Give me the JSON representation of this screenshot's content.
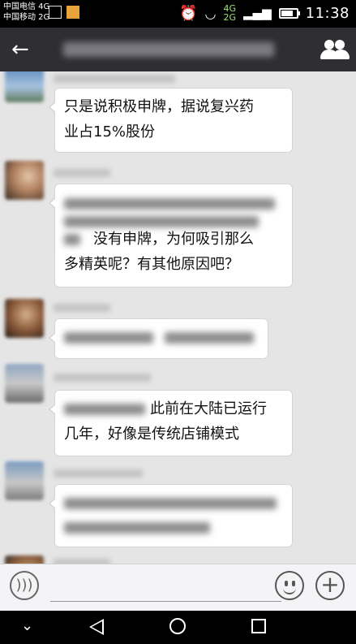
{
  "status_bar": {
    "carrier_1": "中国电信 4G",
    "carrier_2": "中国移动 2G",
    "network_1": "4G",
    "network_2": "2G",
    "time": "11:38",
    "icons": [
      "image-icon",
      "notification-app-icon",
      "alarm-icon",
      "wifi-icon",
      "signal-icon",
      "battery-icon"
    ]
  },
  "header": {
    "back_icon": "←",
    "group_icon": "group-members-icon"
  },
  "messages": [
    {
      "lines": [
        "只是说积极申牌，据说复兴药",
        "业占15%股份"
      ]
    },
    {
      "lines": [
        "没有申牌，为何吸引那么",
        "多精英呢？有其他原因吧？"
      ]
    },
    {
      "lines": []
    },
    {
      "lines": [
        "此前在大陆已运行",
        "几年，好像是传统店铺模式"
      ]
    },
    {
      "lines": []
    }
  ],
  "input_bar": {
    "voice_icon": "voice-icon",
    "emoji_icon": "emoji-icon",
    "plus_icon": "+"
  },
  "nav_bar": {
    "icons": [
      "collapse-icon",
      "back-icon",
      "home-icon",
      "recents-icon"
    ]
  },
  "colors": {
    "header_bg": "#2f2f33",
    "chat_bg": "#e5e5e5",
    "bubble_bg": "#ffffff"
  }
}
